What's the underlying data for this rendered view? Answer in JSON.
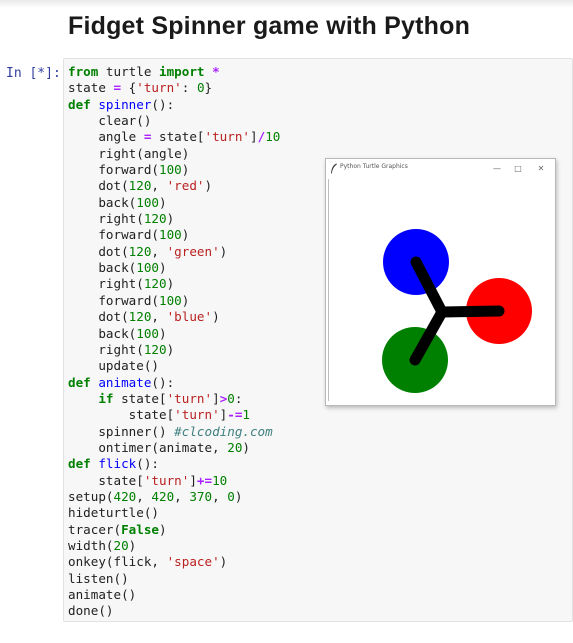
{
  "page": {
    "title": "Fidget Spinner game with Python"
  },
  "notebook": {
    "prompt": "In [*]:",
    "code_lines": [
      [
        [
          "kw",
          "from"
        ],
        [
          "t",
          " turtle "
        ],
        [
          "kw",
          "import"
        ],
        [
          "t",
          " "
        ],
        [
          "op",
          "*"
        ]
      ],
      [
        [
          "t",
          "state "
        ],
        [
          "op",
          "="
        ],
        [
          "t",
          " {"
        ],
        [
          "str",
          "'turn'"
        ],
        [
          "t",
          ": "
        ],
        [
          "num",
          "0"
        ],
        [
          "t",
          "}"
        ]
      ],
      [
        [
          "kw",
          "def"
        ],
        [
          "t",
          " "
        ],
        [
          "fn",
          "spinner"
        ],
        [
          "t",
          "():"
        ]
      ],
      [
        [
          "t",
          "    clear()"
        ]
      ],
      [
        [
          "t",
          "    angle "
        ],
        [
          "op",
          "="
        ],
        [
          "t",
          " state["
        ],
        [
          "str",
          "'turn'"
        ],
        [
          "t",
          "]"
        ],
        [
          "op",
          "/"
        ],
        [
          "num",
          "10"
        ]
      ],
      [
        [
          "t",
          "    right(angle)"
        ]
      ],
      [
        [
          "t",
          "    forward("
        ],
        [
          "num",
          "100"
        ],
        [
          "t",
          ")"
        ]
      ],
      [
        [
          "t",
          "    dot("
        ],
        [
          "num",
          "120"
        ],
        [
          "t",
          ", "
        ],
        [
          "str",
          "'red'"
        ],
        [
          "t",
          ")"
        ]
      ],
      [
        [
          "t",
          "    back("
        ],
        [
          "num",
          "100"
        ],
        [
          "t",
          ")"
        ]
      ],
      [
        [
          "t",
          "    right("
        ],
        [
          "num",
          "120"
        ],
        [
          "t",
          ")"
        ]
      ],
      [
        [
          "t",
          "    forward("
        ],
        [
          "num",
          "100"
        ],
        [
          "t",
          ")"
        ]
      ],
      [
        [
          "t",
          "    dot("
        ],
        [
          "num",
          "120"
        ],
        [
          "t",
          ", "
        ],
        [
          "str",
          "'green'"
        ],
        [
          "t",
          ")"
        ]
      ],
      [
        [
          "t",
          "    back("
        ],
        [
          "num",
          "100"
        ],
        [
          "t",
          ")"
        ]
      ],
      [
        [
          "t",
          "    right("
        ],
        [
          "num",
          "120"
        ],
        [
          "t",
          ")"
        ]
      ],
      [
        [
          "t",
          "    forward("
        ],
        [
          "num",
          "100"
        ],
        [
          "t",
          ")"
        ]
      ],
      [
        [
          "t",
          "    dot("
        ],
        [
          "num",
          "120"
        ],
        [
          "t",
          ", "
        ],
        [
          "str",
          "'blue'"
        ],
        [
          "t",
          ")"
        ]
      ],
      [
        [
          "t",
          "    back("
        ],
        [
          "num",
          "100"
        ],
        [
          "t",
          ")"
        ]
      ],
      [
        [
          "t",
          "    right("
        ],
        [
          "num",
          "120"
        ],
        [
          "t",
          ")"
        ]
      ],
      [
        [
          "t",
          "    update()"
        ]
      ],
      [
        [
          "kw",
          "def"
        ],
        [
          "t",
          " "
        ],
        [
          "fn",
          "animate"
        ],
        [
          "t",
          "():"
        ]
      ],
      [
        [
          "t",
          "    "
        ],
        [
          "kw",
          "if"
        ],
        [
          "t",
          " state["
        ],
        [
          "str",
          "'turn'"
        ],
        [
          "t",
          "]"
        ],
        [
          "op",
          ">"
        ],
        [
          "num",
          "0"
        ],
        [
          "t",
          ":"
        ]
      ],
      [
        [
          "t",
          "        state["
        ],
        [
          "str",
          "'turn'"
        ],
        [
          "t",
          "]"
        ],
        [
          "op",
          "-="
        ],
        [
          "num",
          "1"
        ]
      ],
      [
        [
          "t",
          "    spinner() "
        ],
        [
          "cm",
          "#clcoding.com"
        ]
      ],
      [
        [
          "t",
          "    ontimer(animate, "
        ],
        [
          "num",
          "20"
        ],
        [
          "t",
          ")"
        ]
      ],
      [
        [
          "kw",
          "def"
        ],
        [
          "t",
          " "
        ],
        [
          "fn",
          "flick"
        ],
        [
          "t",
          "():"
        ]
      ],
      [
        [
          "t",
          "    state["
        ],
        [
          "str",
          "'turn'"
        ],
        [
          "t",
          "]"
        ],
        [
          "op",
          "+="
        ],
        [
          "num",
          "10"
        ]
      ],
      [
        [
          "t",
          "setup("
        ],
        [
          "num",
          "420"
        ],
        [
          "t",
          ", "
        ],
        [
          "num",
          "420"
        ],
        [
          "t",
          ", "
        ],
        [
          "num",
          "370"
        ],
        [
          "t",
          ", "
        ],
        [
          "num",
          "0"
        ],
        [
          "t",
          ")"
        ]
      ],
      [
        [
          "t",
          "hideturtle()"
        ]
      ],
      [
        [
          "t",
          "tracer("
        ],
        [
          "kw",
          "False"
        ],
        [
          "t",
          ")"
        ]
      ],
      [
        [
          "t",
          "width("
        ],
        [
          "num",
          "20"
        ],
        [
          "t",
          ")"
        ]
      ],
      [
        [
          "t",
          "onkey(flick, "
        ],
        [
          "str",
          "'space'"
        ],
        [
          "t",
          ")"
        ]
      ],
      [
        [
          "t",
          "listen()"
        ]
      ],
      [
        [
          "t",
          "animate()"
        ]
      ],
      [
        [
          "t",
          "done()"
        ]
      ]
    ]
  },
  "turtle_window": {
    "title": "Python Turtle Graphics",
    "icons": {
      "app": "feather-icon",
      "minimize": "minimize-icon",
      "maximize": "maximize-icon",
      "close": "close-icon"
    },
    "buttons": {
      "minimize": "—",
      "maximize": "□",
      "close": "✕"
    },
    "spinner": {
      "dots": [
        {
          "color": "#0000ff",
          "name": "blue"
        },
        {
          "color": "#ff0000",
          "name": "red"
        },
        {
          "color": "#008000",
          "name": "green"
        }
      ],
      "arm_color": "#000000"
    }
  }
}
